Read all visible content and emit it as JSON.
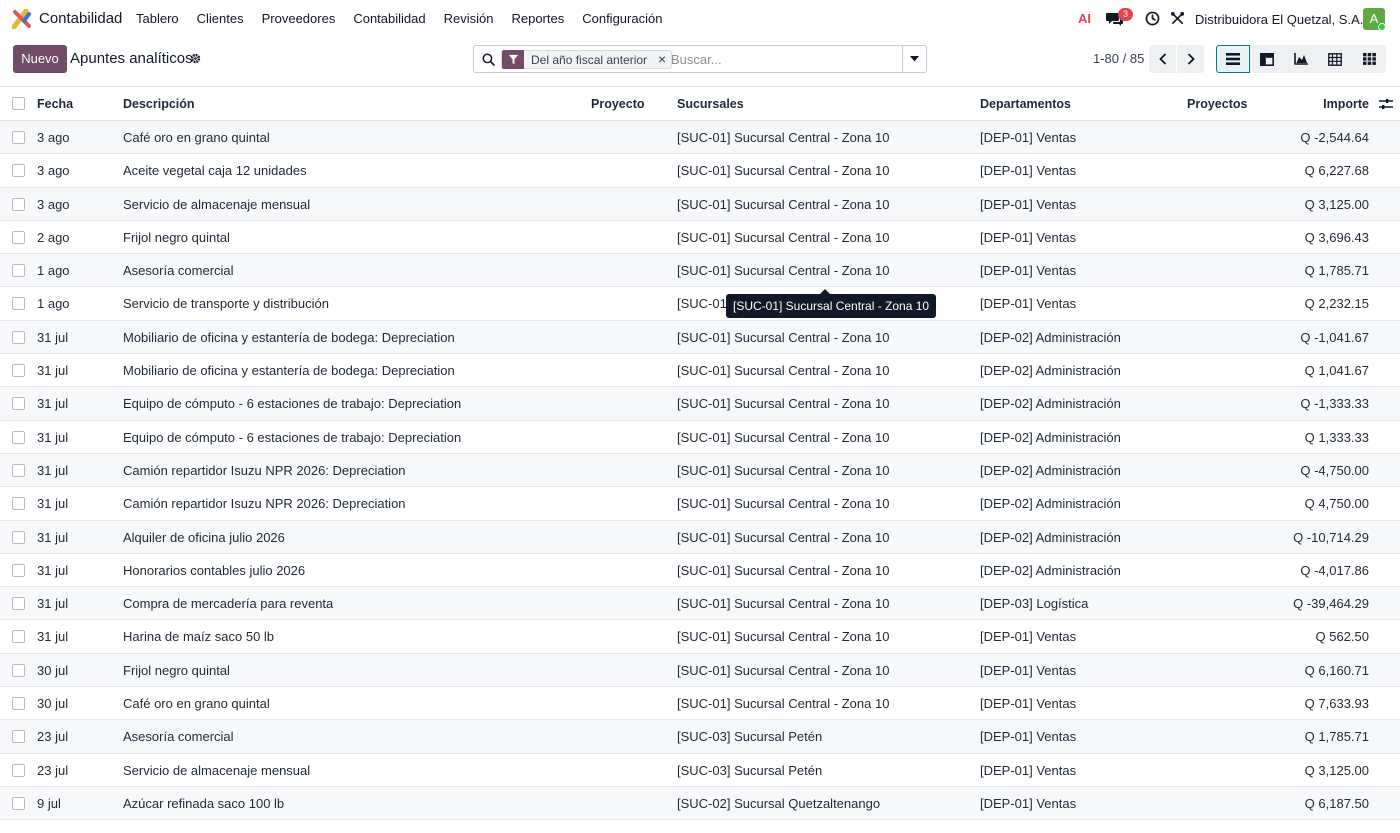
{
  "navbar": {
    "app_name": "Contabilidad",
    "menu": [
      "Tablero",
      "Clientes",
      "Proveedores",
      "Contabilidad",
      "Revisión",
      "Reportes",
      "Configuración"
    ],
    "ai_label": "AI",
    "chat_count": "3",
    "company": "Distribuidora El Quetzal, S.A.",
    "avatar_letter": "A"
  },
  "control": {
    "new_label": "Nuevo",
    "title": "Apuntes analíticos",
    "facet_label": "Del año fiscal anterior",
    "search_placeholder": "Buscar...",
    "pager": "1-80 / 85"
  },
  "table": {
    "headers": {
      "fecha": "Fecha",
      "descripcion": "Descripción",
      "proyecto": "Proyecto",
      "sucursales": "Sucursales",
      "departamentos": "Departamentos",
      "proyectos": "Proyectos",
      "importe": "Importe"
    },
    "rows": [
      [
        "3 ago",
        "Café oro en grano quintal",
        "[SUC-01] Sucursal Central - Zona 10",
        "[DEP-01] Ventas",
        "Q -2,544.64"
      ],
      [
        "3 ago",
        "Aceite vegetal caja 12 unidades",
        "[SUC-01] Sucursal Central - Zona 10",
        "[DEP-01] Ventas",
        "Q 6,227.68"
      ],
      [
        "3 ago",
        "Servicio de almacenaje mensual",
        "[SUC-01] Sucursal Central - Zona 10",
        "[DEP-01] Ventas",
        "Q 3,125.00"
      ],
      [
        "2 ago",
        "Frijol negro quintal",
        "[SUC-01] Sucursal Central - Zona 10",
        "[DEP-01] Ventas",
        "Q 3,696.43"
      ],
      [
        "1 ago",
        "Asesoría comercial",
        "[SUC-01] Sucursal Central - Zona 10",
        "[DEP-01] Ventas",
        "Q 1,785.71"
      ],
      [
        "1 ago",
        "Servicio de transporte y distribución",
        "[SUC-01",
        "[DEP-01] Ventas",
        "Q 2,232.15"
      ],
      [
        "31 jul",
        "Mobiliario de oficina y estantería de bodega: Depreciation",
        "[SUC-01] Sucursal Central - Zona 10",
        "[DEP-02] Administración",
        "Q -1,041.67"
      ],
      [
        "31 jul",
        "Mobiliario de oficina y estantería de bodega: Depreciation",
        "[SUC-01] Sucursal Central - Zona 10",
        "[DEP-02] Administración",
        "Q 1,041.67"
      ],
      [
        "31 jul",
        "Equipo de cómputo - 6 estaciones de trabajo: Depreciation",
        "[SUC-01] Sucursal Central - Zona 10",
        "[DEP-02] Administración",
        "Q -1,333.33"
      ],
      [
        "31 jul",
        "Equipo de cómputo - 6 estaciones de trabajo: Depreciation",
        "[SUC-01] Sucursal Central - Zona 10",
        "[DEP-02] Administración",
        "Q 1,333.33"
      ],
      [
        "31 jul",
        "Camión repartidor Isuzu NPR 2026: Depreciation",
        "[SUC-01] Sucursal Central - Zona 10",
        "[DEP-02] Administración",
        "Q -4,750.00"
      ],
      [
        "31 jul",
        "Camión repartidor Isuzu NPR 2026: Depreciation",
        "[SUC-01] Sucursal Central - Zona 10",
        "[DEP-02] Administración",
        "Q 4,750.00"
      ],
      [
        "31 jul",
        "Alquiler de oficina julio 2026",
        "[SUC-01] Sucursal Central - Zona 10",
        "[DEP-02] Administración",
        "Q -10,714.29"
      ],
      [
        "31 jul",
        "Honorarios contables julio 2026",
        "[SUC-01] Sucursal Central - Zona 10",
        "[DEP-02] Administración",
        "Q -4,017.86"
      ],
      [
        "31 jul",
        "Compra de mercadería para reventa",
        "[SUC-01] Sucursal Central - Zona 10",
        "[DEP-03] Logística",
        "Q -39,464.29"
      ],
      [
        "31 jul",
        "Harina de maíz saco 50 lb",
        "[SUC-01] Sucursal Central - Zona 10",
        "[DEP-01] Ventas",
        "Q 562.50"
      ],
      [
        "30 jul",
        "Frijol negro quintal",
        "[SUC-01] Sucursal Central - Zona 10",
        "[DEP-01] Ventas",
        "Q 6,160.71"
      ],
      [
        "30 jul",
        "Café oro en grano quintal",
        "[SUC-01] Sucursal Central - Zona 10",
        "[DEP-01] Ventas",
        "Q 7,633.93"
      ],
      [
        "23 jul",
        "Asesoría comercial",
        "[SUC-03] Sucursal Petén",
        "[DEP-01] Ventas",
        "Q 1,785.71"
      ],
      [
        "23 jul",
        "Servicio de almacenaje mensual",
        "[SUC-03] Sucursal Petén",
        "[DEP-01] Ventas",
        "Q 3,125.00"
      ],
      [
        "9 jul",
        "Azúcar refinada saco 100 lb",
        "[SUC-02] Sucursal Quetzaltenango",
        "[DEP-01] Ventas",
        "Q 6,187.50"
      ]
    ]
  },
  "tooltip": "[SUC-01] Sucursal Central - Zona 10"
}
